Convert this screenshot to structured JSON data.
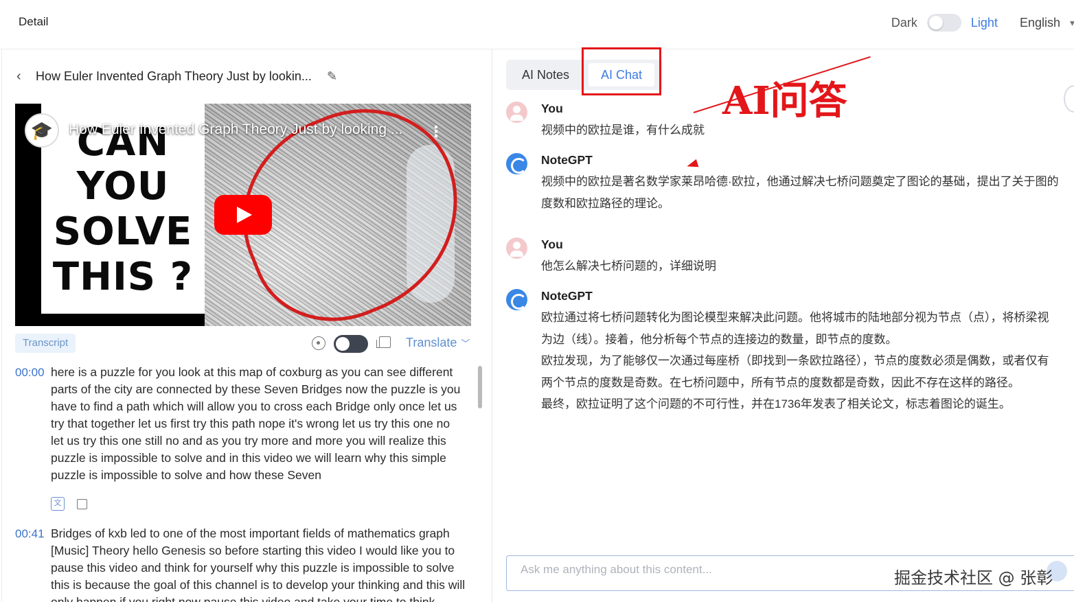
{
  "header": {
    "title": "Detail",
    "theme_dark_label": "Dark",
    "theme_light_label": "Light",
    "language": "English",
    "theme_mode": "light"
  },
  "video": {
    "page_title": "How Euler Invented Graph Theory Just by lookin...",
    "player_title": "How Euler Invented Graph Theory Just by looking ...",
    "thumbnail_text": [
      "CAN",
      "YOU",
      "SOLVE",
      "THIS ?"
    ],
    "play_icon": "youtube-play-icon"
  },
  "toolbar": {
    "transcript_label": "Transcript",
    "translate_label": "Translate",
    "translate_toggle_on": false
  },
  "transcript": [
    {
      "time": "00:00",
      "text": "here is a puzzle for you look at this map of coxburg as you can see different parts of the city are connected by these Seven Bridges now the puzzle is you have to find a path which will allow you to cross each Bridge only once let us try that together let us first try this path nope it's wrong let us try this one no let us try this one still no and as you try more and more you will realize this puzzle is impossible to solve and in this video we will learn why this simple puzzle is impossible to solve and how these Seven"
    },
    {
      "time": "00:41",
      "text": "Bridges of kxb led to one of the most important fields of mathematics graph [Music] Theory hello Genesis so before starting this video I would like you to pause this video and think for yourself why this puzzle is impossible to solve this is because the goal of this channel is to develop your thinking and this will only happen if you right now pause this video and take your time to think"
    }
  ],
  "tabs": {
    "notes_label": "AI Notes",
    "chat_label": "AI Chat",
    "active": "AI Chat"
  },
  "annotation": {
    "text": "AI问答",
    "color": "#e3161a"
  },
  "chat": [
    {
      "sender": "You",
      "text": "视频中的欧拉是谁，有什么成就"
    },
    {
      "sender": "NoteGPT",
      "text": "视频中的欧拉是著名数学家莱昂哈德·欧拉，他通过解决七桥问题奠定了图论的基础，提出了关于图的\n度数和欧拉路径的理论。"
    },
    {
      "sender": "You",
      "text": "他怎么解决七桥问题的，详细说明"
    },
    {
      "sender": "NoteGPT",
      "text": "欧拉通过将七桥问题转化为图论模型来解决此问题。他将城市的陆地部分视为节点（点），将桥梁视\n为边（线）。接着，他分析每个节点的连接边的数量，即节点的度数。\n欧拉发现，为了能够仅一次通过每座桥（即找到一条欧拉路径），节点的度数必须是偶数，或者仅有\n两个节点的度数是奇数。在七桥问题中，所有节点的度数都是奇数，因此不存在这样的路径。\n最终，欧拉证明了这个问题的不可行性，并在1736年发表了相关论文，标志着图论的诞生。"
    }
  ],
  "input": {
    "placeholder": "Ask me anything about this content..."
  },
  "watermark": "掘金技术社区 @ 张彰",
  "colors": {
    "accent": "#3e7be0",
    "timestamp": "#3b74c9",
    "annotation_red": "#e3161a",
    "bot_avatar": "#3a87e6"
  }
}
